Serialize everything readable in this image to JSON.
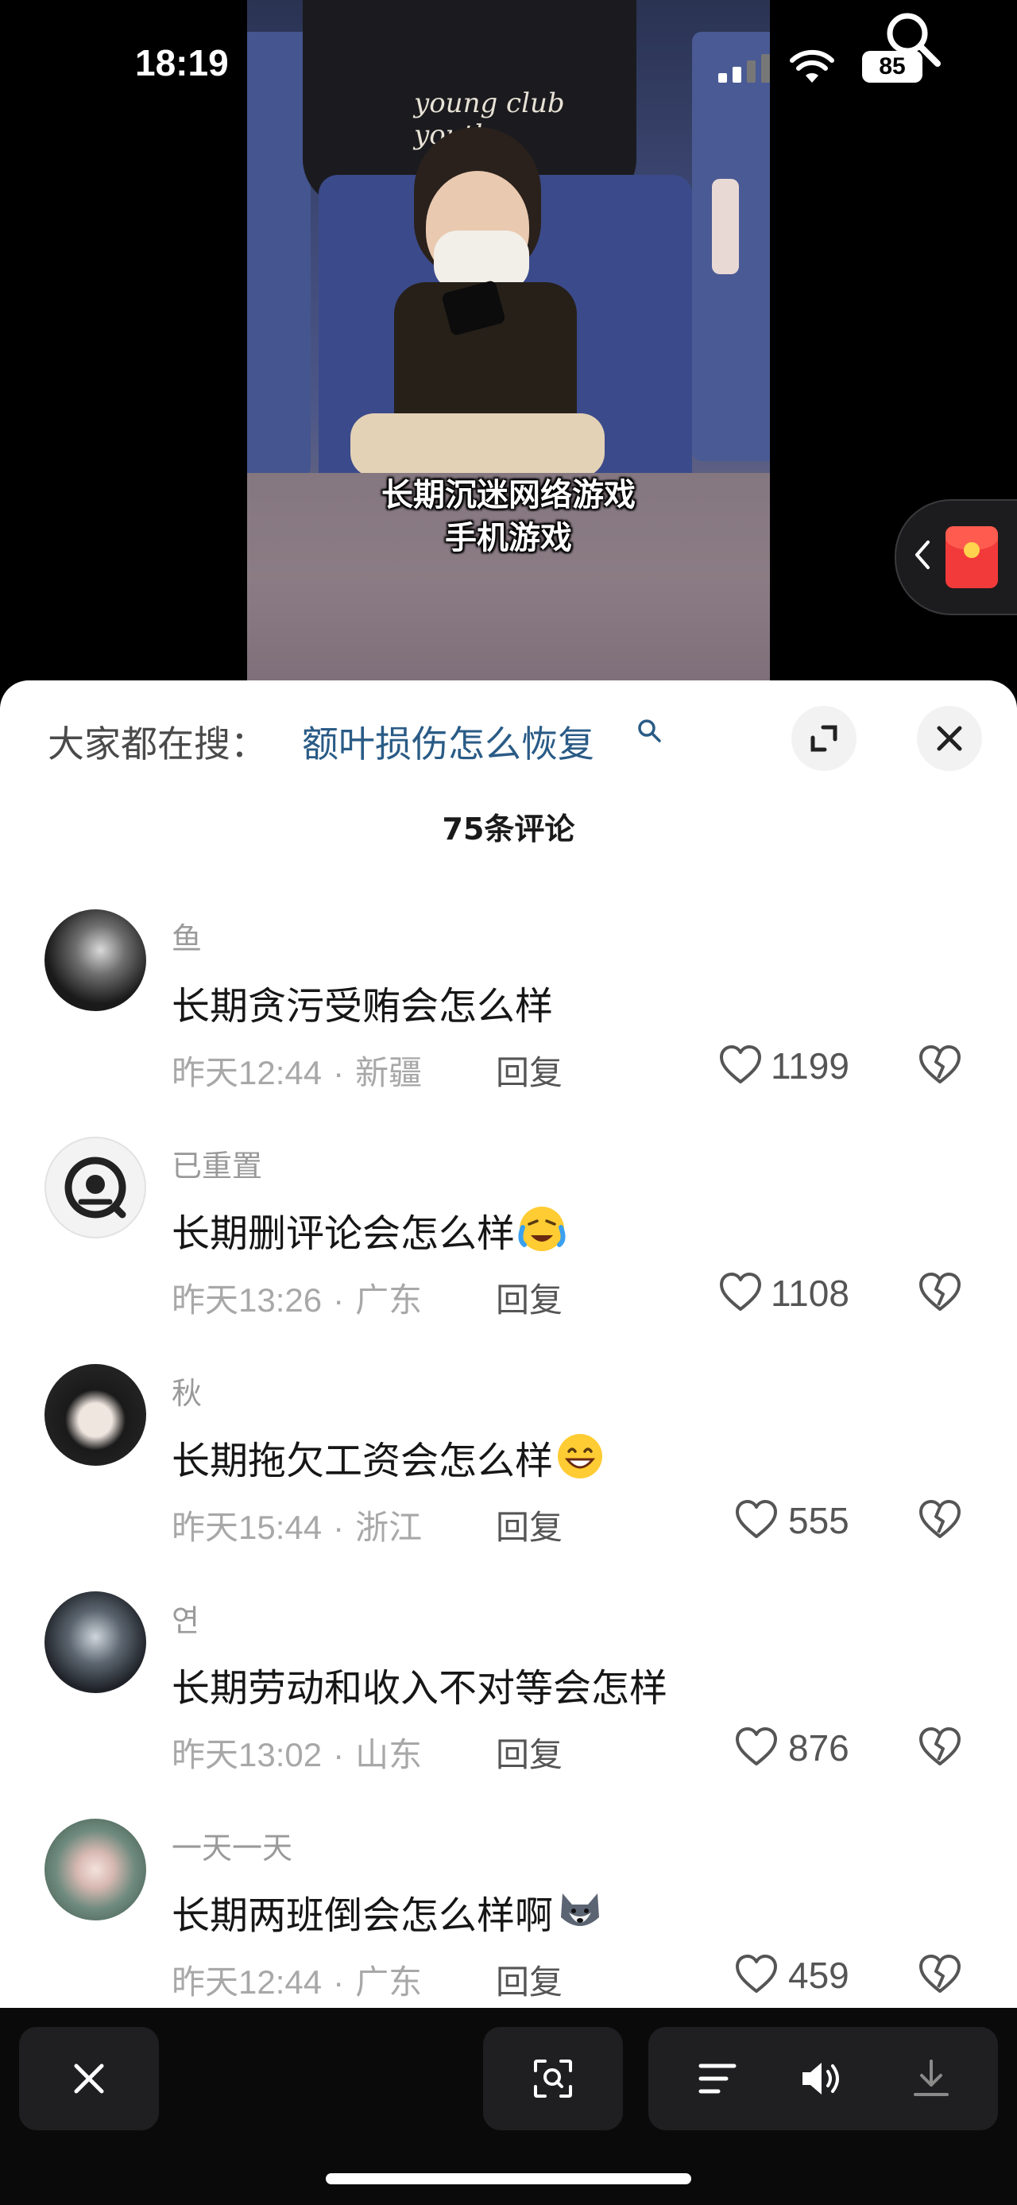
{
  "status_bar": {
    "time": "18:19",
    "battery": "85"
  },
  "video": {
    "shirt_print": "young club youth",
    "caption_line1": "长期沉迷网络游戏",
    "caption_line2": "手机游戏"
  },
  "comments_panel": {
    "search_prefix": "大家都在搜：",
    "search_query": "额叶损伤怎么恢复",
    "count_label": "75条评论",
    "comments": [
      {
        "username": "鱼",
        "text": "长期贪污受贿会怎么样",
        "emoji": "",
        "time": "昨天12:44",
        "location": "新疆",
        "reply_label": "回复",
        "likes": "1199"
      },
      {
        "username": "已重置",
        "text": "长期删评论会怎么样",
        "emoji": "loudly-crying-face",
        "time": "昨天13:26",
        "location": "广东",
        "reply_label": "回复",
        "likes": "1108"
      },
      {
        "username": "秋",
        "text": "长期拖欠工资会怎么样",
        "emoji": "grinning-face",
        "time": "昨天15:44",
        "location": "浙江",
        "reply_label": "回复",
        "likes": "555"
      },
      {
        "username": "연",
        "text": "长期劳动和收入不对等会怎样",
        "emoji": "",
        "time": "昨天13:02",
        "location": "山东",
        "reply_label": "回复",
        "likes": "876"
      },
      {
        "username": "一天一天",
        "text": "长期两班倒会怎么样啊",
        "emoji": "husky-face",
        "time": "昨天12:44",
        "location": "广东",
        "reply_label": "回复",
        "likes": "459"
      }
    ]
  },
  "toolbar": {
    "icons": [
      "close-icon",
      "lens-search-icon",
      "menu-lines-icon",
      "speaker-icon",
      "download-icon"
    ]
  },
  "colors": {
    "search_link": "#2a5b86",
    "sheet_bg": "#ffffff",
    "toolbar_bg": "#0a0a0a",
    "red_envelope": "#f23a3a"
  }
}
